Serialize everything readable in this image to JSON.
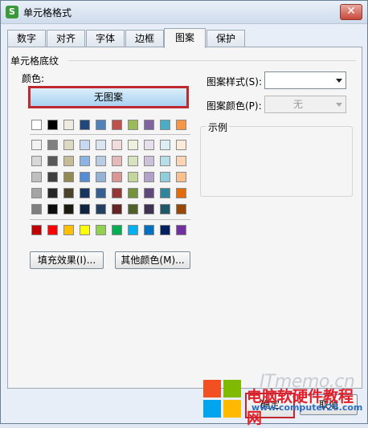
{
  "window": {
    "title": "单元格格式",
    "app_icon_letter": "S"
  },
  "tabs": [
    "数字",
    "对齐",
    "字体",
    "边框",
    "图案",
    "保护"
  ],
  "active_tab": "图案",
  "group_title": "单元格底纹",
  "color_label": "颜色:",
  "no_pattern_label": "无图案",
  "palette": {
    "top_row": [
      "#ffffff",
      "#000000",
      "#eeece1",
      "#1f497d",
      "#4f81bd",
      "#c0504d",
      "#9bbb59",
      "#8064a2",
      "#4bacc6",
      "#f79646"
    ],
    "theme_rows": [
      [
        "#f2f2f2",
        "#7f7f7f",
        "#ddd9c3",
        "#c6d9f0",
        "#dbe5f1",
        "#f2dcdb",
        "#ebf1dd",
        "#e5e0ec",
        "#dbeef3",
        "#fdeada"
      ],
      [
        "#d8d8d8",
        "#595959",
        "#c4bd97",
        "#8db3e2",
        "#b8cce4",
        "#e5b9b7",
        "#d7e3bc",
        "#ccc1d9",
        "#b7dde8",
        "#fbd5b5"
      ],
      [
        "#bfbfbf",
        "#3f3f3f",
        "#938953",
        "#548dd4",
        "#95b3d7",
        "#d99694",
        "#c3d69b",
        "#b2a2c7",
        "#92cddc",
        "#fac08f"
      ],
      [
        "#a5a5a5",
        "#262626",
        "#494429",
        "#17365d",
        "#366092",
        "#953734",
        "#76923c",
        "#5f497a",
        "#31859b",
        "#e36c09"
      ],
      [
        "#7f7f7f",
        "#0c0c0c",
        "#1d1b10",
        "#0f243e",
        "#244061",
        "#632423",
        "#4f6128",
        "#3f3151",
        "#205867",
        "#974806"
      ]
    ],
    "standard_row": [
      "#c00000",
      "#ff0000",
      "#ffc000",
      "#ffff00",
      "#92d050",
      "#00b050",
      "#00b0f0",
      "#0070c0",
      "#002060",
      "#7030a0"
    ]
  },
  "fill_effects_label": "填充效果(I)...",
  "more_colors_label": "其他颜色(M)...",
  "pattern_style_label": "图案样式(S):",
  "pattern_style_value": "",
  "pattern_color_label": "图案颜色(P):",
  "pattern_color_value": "无",
  "sample_label": "示例",
  "ok_label": "确定",
  "cancel_label": "取消",
  "watermark": {
    "logo_text": "ITmemo.cn",
    "site_cn": "电脑软硬件教程网",
    "site_url": "www.computer26.com"
  }
}
